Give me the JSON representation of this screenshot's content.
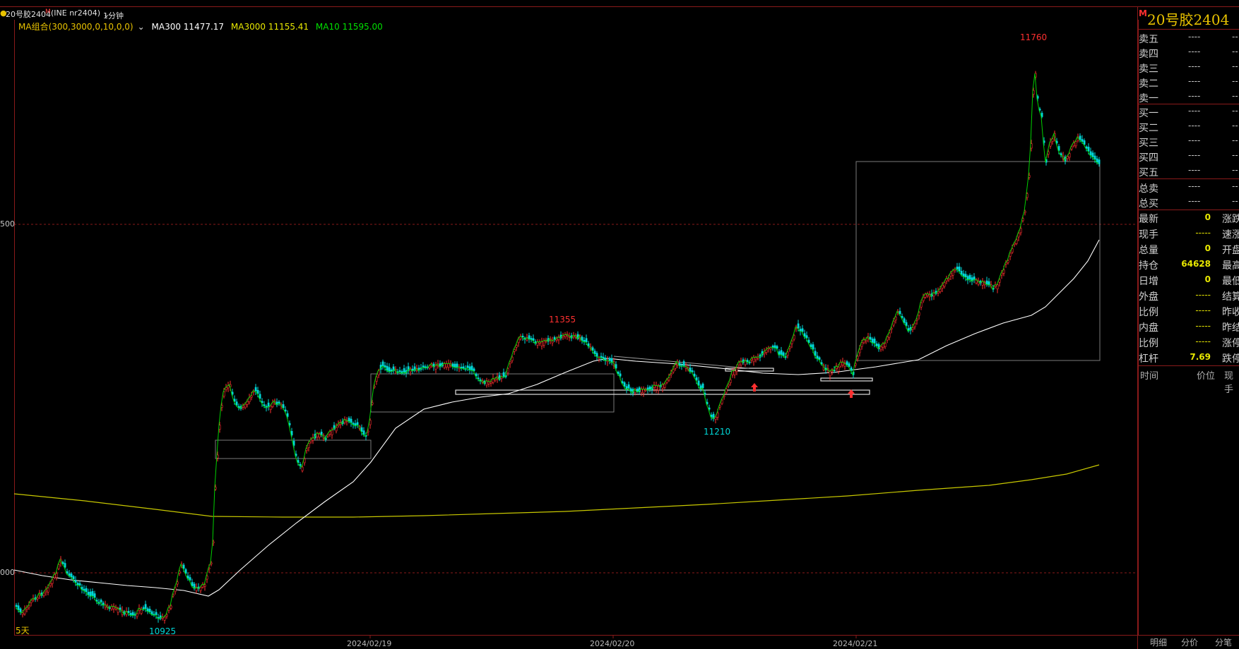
{
  "title_bar": {
    "symbol": "20号胶2404",
    "exchange": "(INE nr2404)",
    "period": "1分钟"
  },
  "indicator_bar": {
    "name": "MA组合(300,3000,0,10,0,0)",
    "ma300": "MA300 11477.17",
    "ma3000": "MA3000 11155.41",
    "ma10": "MA10 11595.00"
  },
  "y_axis": {
    "tick_upper": "500",
    "tick_lower": "000"
  },
  "x_axis": {
    "dates": [
      "2024/02/19",
      "2024/02/20",
      "2024/02/21"
    ]
  },
  "annotations": {
    "high": "11760",
    "local_high": "11355",
    "local_low": "11210",
    "low": "10925",
    "range_label": "5天"
  },
  "colors": {
    "up": "#ff3030",
    "down": "#00d8d8",
    "ma300": "#ffffff",
    "ma3000": "#d8d800",
    "ma10": "#00e000",
    "grid_red": "#8a1a1a"
  },
  "panel": {
    "title": "20号胶2404",
    "badge": "M",
    "asks": [
      {
        "label": "卖五",
        "price": "----",
        "vol": "--"
      },
      {
        "label": "卖四",
        "price": "----",
        "vol": "--"
      },
      {
        "label": "卖三",
        "price": "----",
        "vol": "--"
      },
      {
        "label": "卖二",
        "price": "----",
        "vol": "--"
      },
      {
        "label": "卖一",
        "price": "----",
        "vol": "--"
      }
    ],
    "bids": [
      {
        "label": "买一",
        "price": "----",
        "vol": "--"
      },
      {
        "label": "买二",
        "price": "----",
        "vol": "--"
      },
      {
        "label": "买三",
        "price": "----",
        "vol": "--"
      },
      {
        "label": "买四",
        "price": "----",
        "vol": "--"
      },
      {
        "label": "买五",
        "price": "----",
        "vol": "--"
      }
    ],
    "totals": [
      {
        "label": "总卖",
        "price": "----",
        "vol": "--"
      },
      {
        "label": "总买",
        "price": "----",
        "vol": "--"
      }
    ],
    "info": [
      {
        "label": "最新",
        "value": "0",
        "label2": "涨跌"
      },
      {
        "label": "现手",
        "value": "-----",
        "label2": "速涨"
      },
      {
        "label": "总量",
        "value": "0",
        "label2": "开盘"
      },
      {
        "label": "持仓",
        "value": "64628",
        "label2": "最高"
      },
      {
        "label": "日增",
        "value": "0",
        "label2": "最低"
      },
      {
        "label": "外盘",
        "value": "-----",
        "label2": "结算"
      },
      {
        "label": "比例",
        "value": "-----",
        "label2": "昨收"
      },
      {
        "label": "内盘",
        "value": "-----",
        "label2": "昨结"
      },
      {
        "label": "比例",
        "value": "-----",
        "label2": "涨停"
      },
      {
        "label": "杠杆",
        "value": "7.69",
        "label2": "跌停"
      }
    ],
    "trade_header": {
      "time": "时间",
      "price": "价位",
      "vol": "现手"
    },
    "tabs": [
      "明细",
      "分价",
      "分笔"
    ]
  }
}
